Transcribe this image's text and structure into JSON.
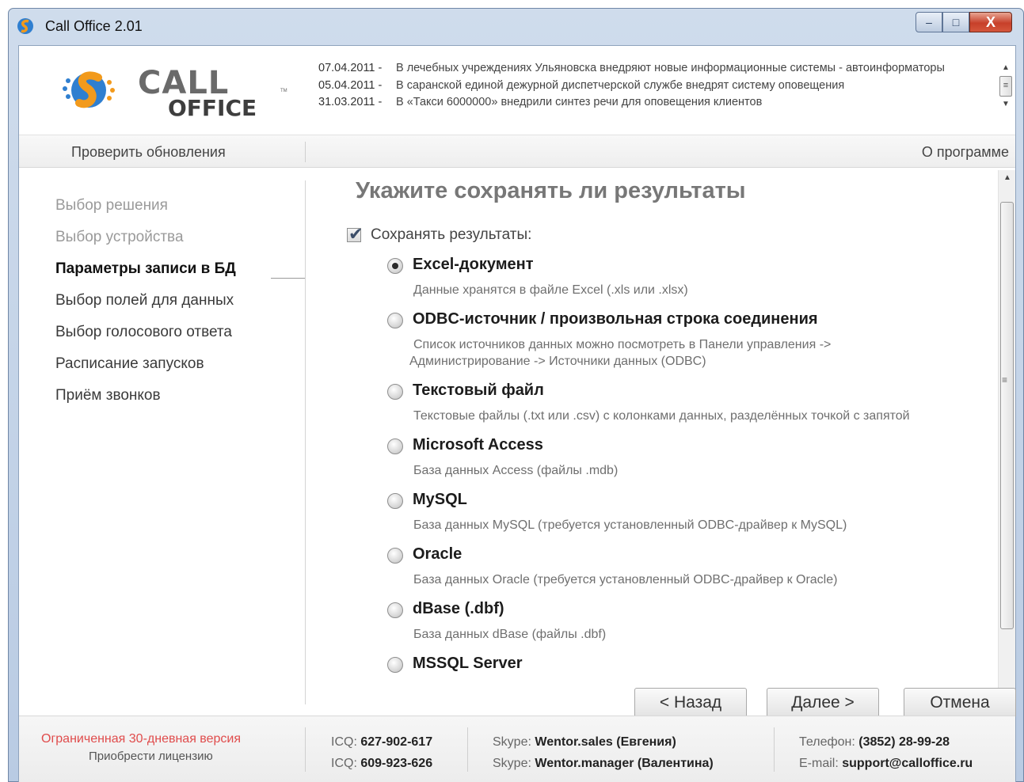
{
  "window": {
    "title": "Call Office 2.01",
    "controls": {
      "minimize": "–",
      "maximize": "□",
      "close": "X"
    }
  },
  "logo": {
    "call": "CALL",
    "office": "OFFICE",
    "tm": "TM"
  },
  "news": [
    {
      "date": "07.04.2011 -",
      "text": "В лечебных учреждениях Ульяновска внедряют новые информационные системы - автоинформаторы"
    },
    {
      "date": "05.04.2011 -",
      "text": "В саранской единой дежурной диспетчерской службе внедрят систему оповещения"
    },
    {
      "date": "31.03.2011 -",
      "text": "В «Такси 6000000» внедрили синтез речи для оповещения клиентов"
    }
  ],
  "toolbar": {
    "update_label": "Проверить обновления",
    "about_label": "О программе"
  },
  "nav": {
    "items": [
      {
        "label": "Выбор решения",
        "state": "done"
      },
      {
        "label": "Выбор устройства",
        "state": "done"
      },
      {
        "label": "Параметры записи в БД",
        "state": "active"
      },
      {
        "label": "Выбор полей для данных",
        "state": "pending"
      },
      {
        "label": "Выбор голосового ответа",
        "state": "pending"
      },
      {
        "label": "Расписание запусков",
        "state": "pending"
      },
      {
        "label": "Приём звонков",
        "state": "pending"
      }
    ]
  },
  "main": {
    "title": "Укажите сохранять ли результаты",
    "save_checkbox": {
      "label": "Сохранять результаты:",
      "checked": true
    },
    "options": [
      {
        "title": "Excel-документ",
        "desc": [
          "Данные хранятся в файле Excel (.xls или .xlsx)"
        ],
        "selected": true
      },
      {
        "title": "ODBC-источник / произвольная строка соединения",
        "desc": [
          "Список источников данных можно посмотреть в Панели управления ->",
          "Администрирование -> Источники данных (ODBC)"
        ],
        "selected": false
      },
      {
        "title": "Текстовый файл",
        "desc": [
          "Текстовые файлы (.txt или .csv) с колонками данных, разделённых точкой с запятой"
        ],
        "selected": false
      },
      {
        "title": "Microsoft Access",
        "desc": [
          "База данных Access (файлы .mdb)"
        ],
        "selected": false
      },
      {
        "title": "MySQL",
        "desc": [
          "База данных MySQL (требуется установленный ODBC-драйвер к MySQL)"
        ],
        "selected": false
      },
      {
        "title": "Oracle",
        "desc": [
          "База данных Oracle (требуется установленный ODBC-драйвер к Oracle)"
        ],
        "selected": false
      },
      {
        "title": "dBase (.dbf)",
        "desc": [
          "База данных dBase (файлы .dbf)"
        ],
        "selected": false
      },
      {
        "title": "MSSQL Server",
        "desc": [],
        "selected": false
      }
    ]
  },
  "buttons": {
    "back": "< Назад",
    "next": "Далее >",
    "cancel": "Отмена"
  },
  "footer": {
    "trial": "Ограниченная 30-дневная версия",
    "buy": "Приобрести лицензию",
    "icq1_label": "ICQ:",
    "icq1": "627-902-617",
    "icq2_label": "ICQ:",
    "icq2": "609-923-626",
    "skype1_label": "Skype:",
    "skype1": "Wentor.sales (Евгения)",
    "skype2_label": "Skype:",
    "skype2": "Wentor.manager (Валентина)",
    "phone_label": "Телефон:",
    "phone": "(3852) 28-99-28",
    "email_label": "E-mail:",
    "email": "support@calloffice.ru"
  },
  "colors": {
    "accent_orange": "#f29a1c",
    "accent_blue": "#2f7fd0",
    "trial_red": "#e04c4c"
  }
}
